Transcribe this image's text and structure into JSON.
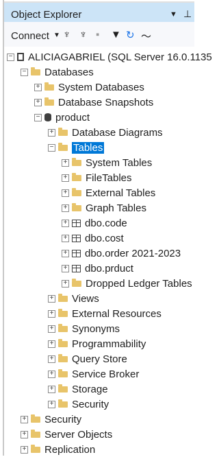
{
  "panel": {
    "title": "Object Explorer"
  },
  "toolbar": {
    "connect_label": "Connect"
  },
  "tree": {
    "server": "ALICIAGABRIEL (SQL Server 16.0.1135",
    "databases": "Databases",
    "system_databases": "System Databases",
    "database_snapshots": "Database Snapshots",
    "product": "product",
    "database_diagrams": "Database Diagrams",
    "tables": "Tables",
    "system_tables": "System Tables",
    "file_tables": "FileTables",
    "external_tables": "External Tables",
    "graph_tables": "Graph Tables",
    "dbo_code": "dbo.code",
    "dbo_cost": "dbo.cost",
    "dbo_order": "dbo.order 2021-2023",
    "dbo_prduct": "dbo.prduct",
    "dropped_ledger_tables": "Dropped Ledger Tables",
    "views": "Views",
    "external_resources": "External Resources",
    "synonyms": "Synonyms",
    "programmability": "Programmability",
    "query_store": "Query Store",
    "service_broker": "Service Broker",
    "storage": "Storage",
    "db_security": "Security",
    "security": "Security",
    "server_objects": "Server Objects",
    "replication": "Replication"
  },
  "icons": {
    "pin": "pin-icon",
    "new_query": "new-query-icon",
    "filter": "filter-icon",
    "refresh": "refresh-icon",
    "activity": "activity-icon"
  },
  "colors": {
    "title_bg": "#cce4f7",
    "selection": "#0078d7",
    "folder": "#e8c46a"
  }
}
